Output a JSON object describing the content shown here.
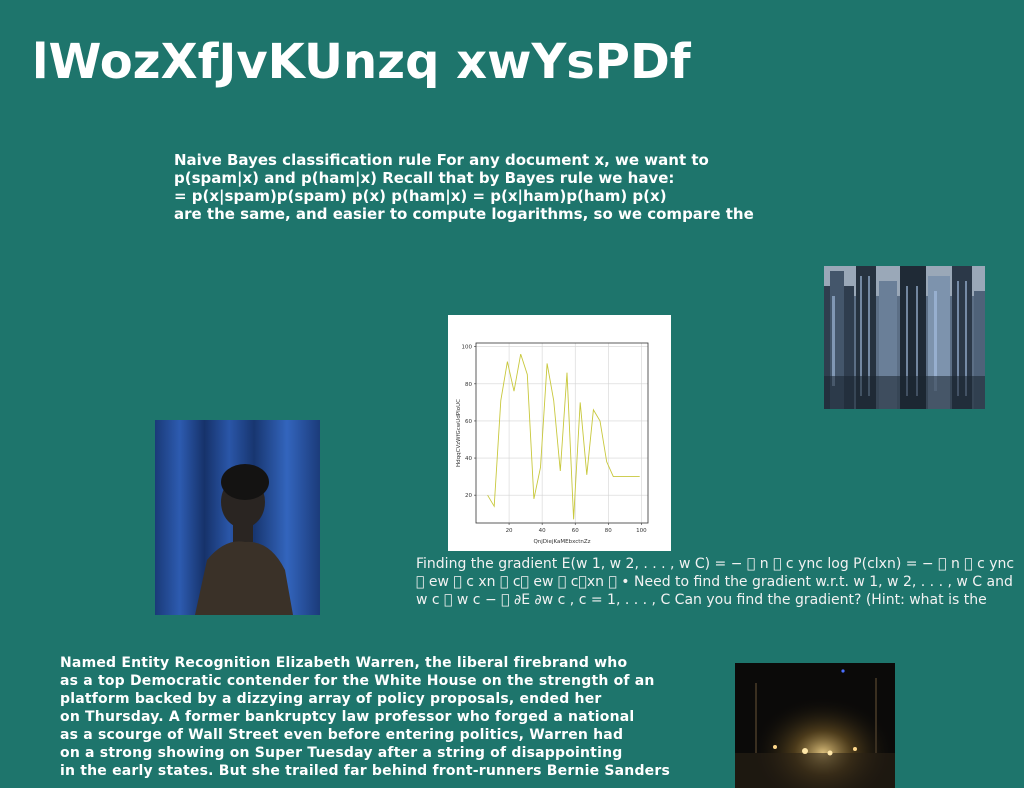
{
  "page": {
    "title": "lWozXfJvKUnzq xwYsPDf"
  },
  "paragraph_naive_bayes": {
    "lines": [
      "Naive Bayes classification rule For any document x, we want to",
      "p(spam|x) and p(ham|x) Recall that by Bayes rule we have:",
      "= p(x|spam)p(spam) p(x) p(ham|x) = p(x|ham)p(ham) p(x)",
      "are the same, and easier to compute logarithms, so we compare the"
    ]
  },
  "paragraph_gradient": {
    "lines": [
      "Finding the gradient E(w 1, w 2, . . . , w C) = − \u0000 n \u0000 c ync log P(clxn) = − \u0000 n \u0000 c ync",
      "\u0000 ew \u0000 c xn \u0000 c\u0000 ew \u0000 c\u0000xn \u0000 • Need to find the gradient w.r.t. w 1, w 2, . . . , w C and",
      "w c \u0000 w c − \u0000 ∂E ∂w c , c = 1, . . . , C Can you find the gradient? (Hint: what is the"
    ]
  },
  "paragraph_ner": {
    "lines": [
      "Named Entity Recognition Elizabeth Warren, the liberal firebrand who",
      "as a top Democratic contender for the White House on the strength of an",
      "platform backed by a dizzying array of policy proposals, ended her",
      "on Thursday. A former bankruptcy law professor who forged a national",
      "as a scourge of Wall Street even before entering politics, Warren had",
      "on a strong showing on Super Tuesday after a string of disappointing",
      "in the early states. But she trailed far behind front-runners Bernie Sanders"
    ]
  },
  "chart_data": {
    "type": "line",
    "title": "",
    "xlabel": "QnjDiejKaMEbxctnZz",
    "ylabel": "HdqqCVzWfGcwUdPIoUC",
    "xlim": [
      0,
      104
    ],
    "ylim": [
      5,
      102
    ],
    "xticks": [
      20,
      40,
      60,
      80,
      100
    ],
    "yticks": [
      20,
      40,
      60,
      80,
      100
    ],
    "grid": true,
    "color": "#c8c83c",
    "series": [
      {
        "x": [
          7,
          11,
          15,
          19,
          23,
          27,
          31,
          35,
          39,
          43,
          47,
          51,
          55,
          59,
          63,
          67,
          71,
          75,
          79,
          83,
          87,
          91,
          95,
          99
        ],
        "y": [
          20,
          14,
          71,
          92,
          76,
          96,
          85,
          18,
          35,
          91,
          71,
          33,
          86,
          7,
          70,
          31,
          66,
          60,
          38,
          30,
          30,
          30,
          30,
          30
        ]
      }
    ]
  },
  "colors": {
    "background": "#1e756c",
    "text": "#ffffff",
    "chart_line": "#c8c83c"
  }
}
